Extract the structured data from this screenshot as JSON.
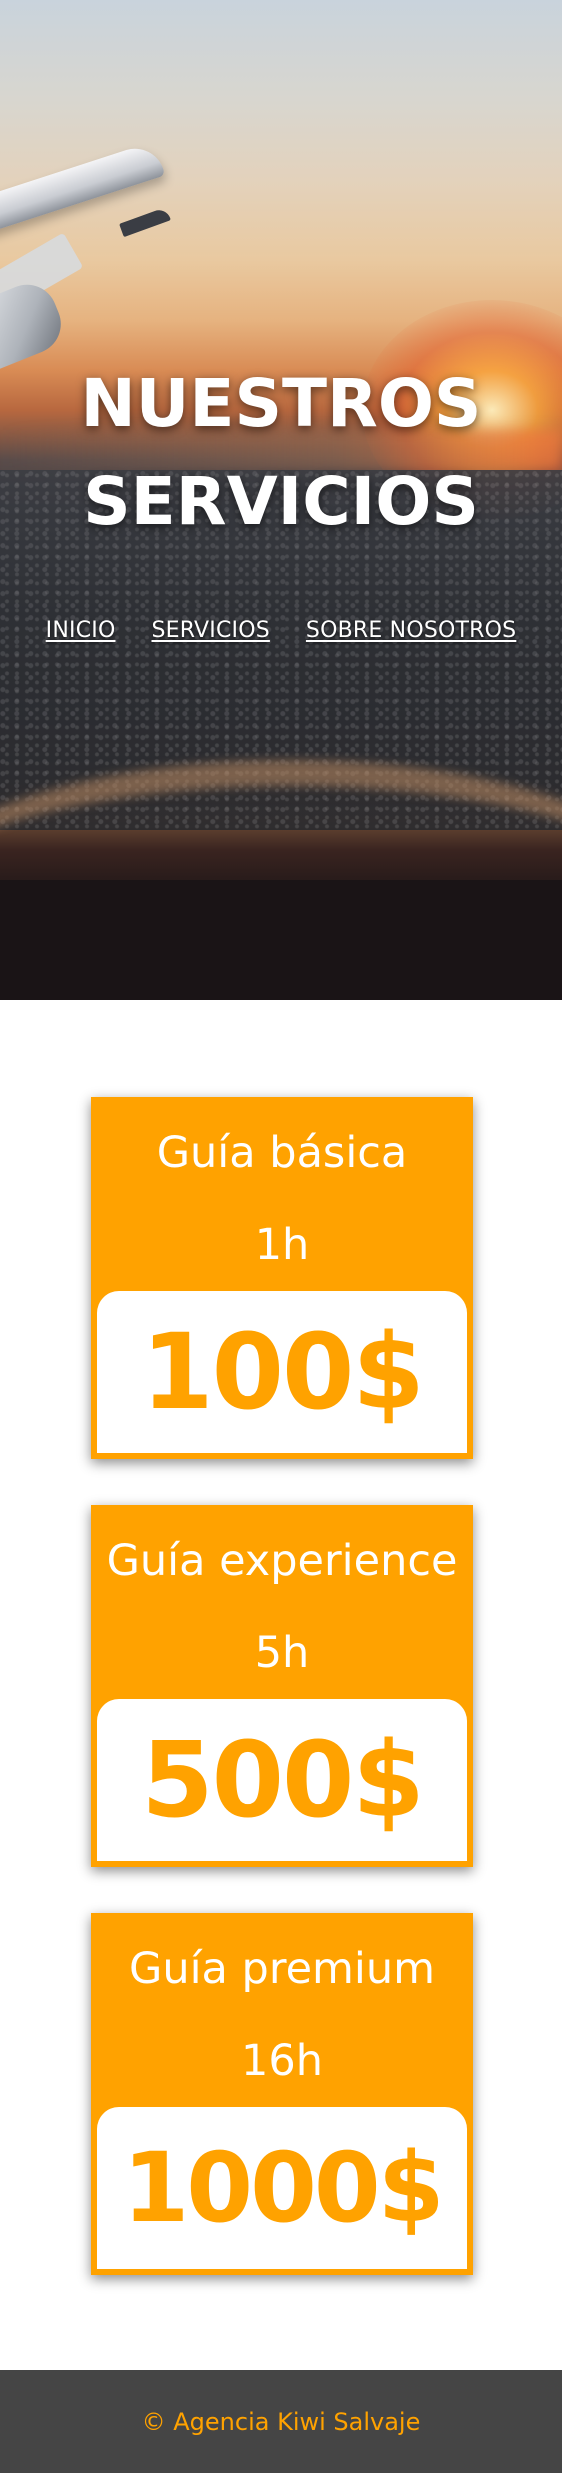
{
  "hero": {
    "title_line1": "NUESTROS",
    "title_line2": "SERVICIOS"
  },
  "nav": {
    "items": [
      {
        "label": "INICIO"
      },
      {
        "label": "SERVICIOS"
      },
      {
        "label": "SOBRE NOSOTROS"
      }
    ]
  },
  "services": [
    {
      "name": "Guía básica",
      "duration": "1h",
      "price": "100$"
    },
    {
      "name": "Guía experience",
      "duration": "5h",
      "price": "500$"
    },
    {
      "name": "Guía premium",
      "duration": "16h",
      "price": "1000$"
    }
  ],
  "footer": {
    "text": "© Agencia Kiwi Salvaje"
  },
  "colors": {
    "accent": "#ffa200",
    "footer_bg": "#454545",
    "text_light": "#ffffff"
  },
  "images": {
    "hero_background": "airplane-window-sunset-photo"
  }
}
